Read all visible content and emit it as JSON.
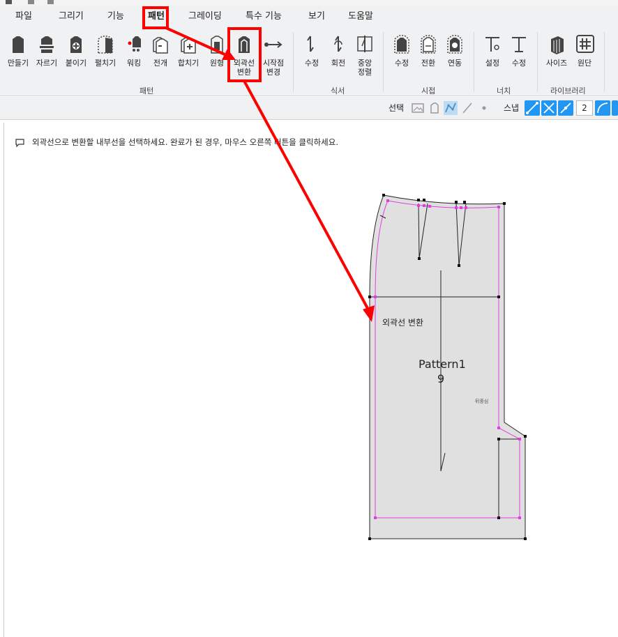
{
  "menu": {
    "items": [
      {
        "label": "파일",
        "active": false
      },
      {
        "label": "그리기",
        "active": false
      },
      {
        "label": "기능",
        "active": false
      },
      {
        "label": "패턴",
        "active": true
      },
      {
        "label": "그레이딩",
        "active": false
      },
      {
        "label": "특수 기능",
        "active": false
      },
      {
        "label": "보기",
        "active": false
      },
      {
        "label": "도움말",
        "active": false
      }
    ]
  },
  "ribbon": {
    "buttons": [
      {
        "label": "만들기",
        "icon": "pattern-make-icon"
      },
      {
        "label": "자르기",
        "icon": "pattern-cut-icon"
      },
      {
        "label": "붙이기",
        "icon": "pattern-attach-icon"
      },
      {
        "label": "펼치기",
        "icon": "pattern-unfold-icon"
      },
      {
        "label": "워킹",
        "icon": "walking-icon"
      },
      {
        "label": "전개",
        "icon": "develop-icon"
      },
      {
        "label": "합치기",
        "icon": "merge-icon"
      },
      {
        "label": "원형",
        "icon": "original-icon"
      },
      {
        "label": "외곽선\n변환",
        "icon": "outline-convert-icon"
      },
      {
        "label": "시작점\n변경",
        "icon": "start-point-icon"
      },
      {
        "label": "수정",
        "icon": "pleat-edit-icon"
      },
      {
        "label": "회전",
        "icon": "pleat-rotate-icon"
      },
      {
        "label": "중앙\n정렬",
        "icon": "center-align-icon"
      },
      {
        "label": "수정",
        "icon": "seam-edit-icon"
      },
      {
        "label": "전환",
        "icon": "seam-switch-icon"
      },
      {
        "label": "연동",
        "icon": "seam-link-icon"
      },
      {
        "label": "설정",
        "icon": "notch-set-icon"
      },
      {
        "label": "수정",
        "icon": "notch-edit-icon"
      },
      {
        "label": "사이즈",
        "icon": "size-library-icon"
      },
      {
        "label": "원단",
        "icon": "fabric-library-icon"
      }
    ],
    "groups": [
      "패턴",
      "식서",
      "시접",
      "너치",
      "라이브러리"
    ]
  },
  "toolbar2": {
    "select_label": "선택",
    "snap_label": "스냅",
    "snap_value": "2"
  },
  "canvas": {
    "hint": "외곽선으로 변환할 내부선을 선택하세요. 완료가 된 경우, 마우스 오른쪽 버튼을 클릭하세요.",
    "tooltip": "외곽선 변환",
    "pattern_name": "Pattern1",
    "pattern_number": "9",
    "pattern_label": "뒤중심"
  },
  "colors": {
    "annotation": "#ff0000",
    "seam": "#e040e0",
    "pattern_fill": "#e0e0e0",
    "snap_active": "#2196f3"
  }
}
